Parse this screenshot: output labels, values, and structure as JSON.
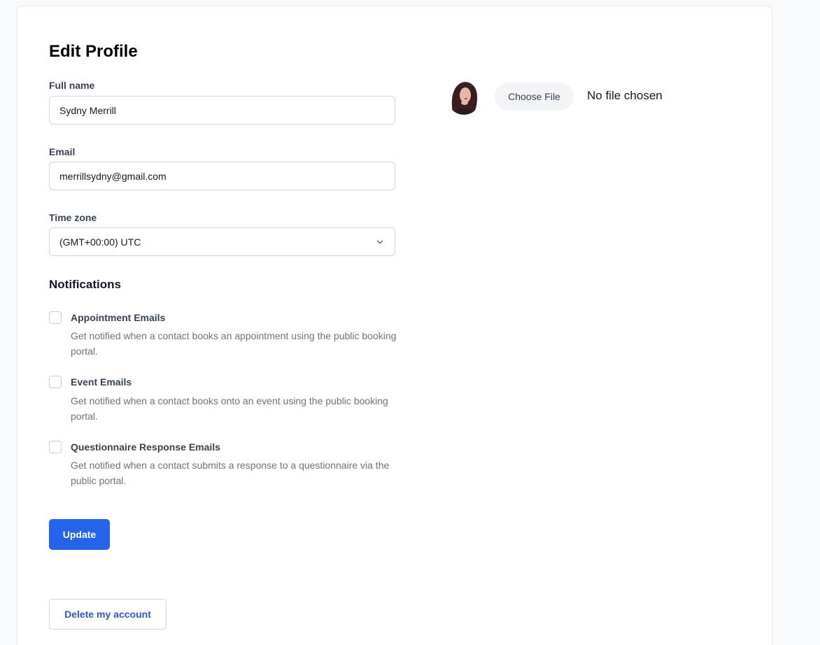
{
  "page": {
    "title": "Edit Profile"
  },
  "form": {
    "full_name": {
      "label": "Full name",
      "value": "Sydny Merrill"
    },
    "email": {
      "label": "Email",
      "value": "merrillsydny@gmail.com"
    },
    "time_zone": {
      "label": "Time zone",
      "value": "(GMT+00:00) UTC"
    }
  },
  "notifications": {
    "title": "Notifications",
    "options": [
      {
        "label": "Appointment Emails",
        "description": "Get notified when a contact books an appointment using the public booking portal.",
        "checked": false
      },
      {
        "label": "Event Emails",
        "description": "Get notified when a contact books onto an event using the public booking portal.",
        "checked": false
      },
      {
        "label": "Questionnaire Response Emails",
        "description": "Get notified when a contact submits a response to a questionnaire via the public portal.",
        "checked": false
      }
    ]
  },
  "actions": {
    "update_label": "Update",
    "delete_label": "Delete my account"
  },
  "avatar_upload": {
    "choose_label": "Choose File",
    "status": "No file chosen"
  },
  "colors": {
    "primary": "#2563eb",
    "link": "#2f55d4",
    "border": "#d1d5db",
    "page_bg": "#f9fafb"
  },
  "icons": {
    "select": "chevron-down-icon"
  }
}
